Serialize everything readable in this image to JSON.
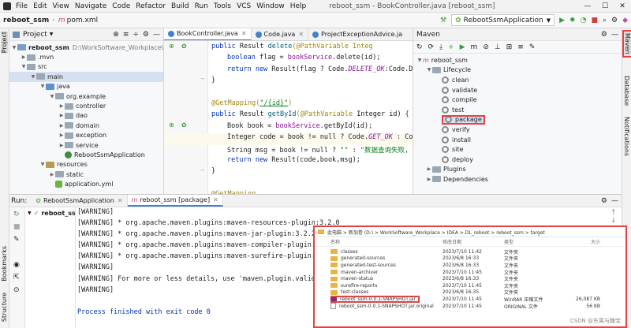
{
  "menubar": {
    "items": [
      "File",
      "Edit",
      "View",
      "Navigate",
      "Code",
      "Refactor",
      "Build",
      "Run",
      "Tools",
      "VCS",
      "Window",
      "Help"
    ],
    "title": "reboot_ssm - BookController.java [reboot_ssm]"
  },
  "navbar": {
    "project": "reboot_ssm",
    "file": "pom.xml",
    "run_config": "RebootSsmApplication"
  },
  "project": {
    "header": "Project",
    "root_name": "reboot_ssm",
    "root_path": "D:\\WorkSoftware_Workplace\\IDEA",
    "nodes": [
      ".mvn",
      "src",
      "main",
      "java",
      "org.example",
      "controller",
      "dao",
      "domain",
      "exception",
      "service",
      "RebootSsmApplication",
      "resources",
      "static",
      "application.yml"
    ]
  },
  "editor": {
    "tabs": [
      "BookController.java",
      "Code.java",
      "ProjectExceptionAdvice.ja"
    ],
    "lines": {
      "l1": {
        "a": "public ",
        "b": "Result ",
        "c": "delete",
        "d": "(@PathVariable Integ"
      },
      "l2": {
        "a": "boolean ",
        "b": "flag = ",
        "c": "bookService",
        "d": ".delete(id);"
      },
      "l3": {
        "a": "return new ",
        "b": "Result(flag ? Code.",
        "c": "DELETE_OK",
        "d": ":Code.D"
      },
      "l4": "}",
      "l6": {
        "a": "@GetMapping(",
        "b": "\"/{id}\"",
        "c": ")"
      },
      "l7": {
        "a": "public ",
        "b": "Result ",
        "c": "getById",
        "d": "(@PathVariable ",
        "e": "Integer ",
        "f": "id) {"
      },
      "l8": {
        "a": "Book book = ",
        "b": "bookService",
        "c": ".getById(id);"
      },
      "l9": {
        "a": "Integer ",
        "b": "code = book != null ? Code.",
        "c": "GET_OK",
        "d": " : Co"
      },
      "l10": {
        "a": "String msg = book != null ? ",
        "b": "\"\"",
        "c": " : ",
        "d": "\"数据查询失败,"
      },
      "l11": {
        "a": "return new ",
        "b": "Result(code,book,msg);"
      },
      "l12": "}",
      "l14": "@GetMapping"
    }
  },
  "maven": {
    "title": "Maven",
    "root": "reboot_ssm",
    "lifecycle": "Lifecycle",
    "goals": [
      "clean",
      "validate",
      "compile",
      "test",
      "package",
      "verify",
      "install",
      "site",
      "deploy"
    ],
    "plugins": "Plugins",
    "dependencies": "Dependencies"
  },
  "right_strip": {
    "maven": "Maven",
    "database": "Database",
    "notifications": "Notifications"
  },
  "left_strip": {
    "project": "Project",
    "bookmarks": "Bookmarks",
    "structure": "Structure"
  },
  "run": {
    "label": "Run:",
    "tab1": "RebootSsmApplication",
    "tab2": "reboot_ssm [package]",
    "tree_item": "reboot_ss",
    "lines": [
      "[WARNING]",
      "[WARNING]  * org.apache.maven.plugins:maven-resources-plugin:3.2.0",
      "[WARNING]  * org.apache.maven.plugins:maven-jar-plugin:3.2.2",
      "[WARNING]  * org.apache.maven.plugins:maven-compiler-plugin:3",
      "[WARNING]  * org.apache.maven.plugins:maven-surefire-plugin:3",
      "[WARNING]",
      "[WARNING] For more or less details, use 'maven.plugin.valida",
      "[WARNING]",
      "",
      "Process finished with exit code 0"
    ]
  },
  "explorer": {
    "breadcrumb": "此电脑 > 新加卷 (D:) > WorkSoftware_Workplace > IDEA > DL_reboot > reboot_ssm > target",
    "headers": [
      "名称",
      "修改日期",
      "类型",
      "大小"
    ],
    "rows": [
      {
        "name": "classes",
        "date": "2023/7/10 11:42",
        "type": "文件夹",
        "size": ""
      },
      {
        "name": "generated-sources",
        "date": "2023/6/8 16:33",
        "type": "文件夹",
        "size": ""
      },
      {
        "name": "generated-test-sources",
        "date": "2023/6/8 16:33",
        "type": "文件夹",
        "size": ""
      },
      {
        "name": "maven-archiver",
        "date": "2023/7/10 11:45",
        "type": "文件夹",
        "size": ""
      },
      {
        "name": "maven-status",
        "date": "2023/6/8 16:33",
        "type": "文件夹",
        "size": ""
      },
      {
        "name": "surefire-reports",
        "date": "2023/7/10 11:45",
        "type": "文件夹",
        "size": ""
      },
      {
        "name": "test-classes",
        "date": "2023/6/8 16:35",
        "type": "文件夹",
        "size": ""
      },
      {
        "name": "reboot_ssm-0.0.1-SNAPSHOT.jar",
        "date": "2023/7/10 11:45",
        "type": "WinRAR 压缩文件",
        "size": "26,087 KB"
      },
      {
        "name": "reboot_ssm-0.0.1-SNAPSHOT.jar.original",
        "date": "2023/7/10 11:45",
        "type": "ORIGINAL 文件",
        "size": "56 KB"
      }
    ],
    "watermark": "CSDN @东离与糖宝"
  },
  "colors": {
    "highlight": "#e04444",
    "accent": "#4083c9"
  }
}
